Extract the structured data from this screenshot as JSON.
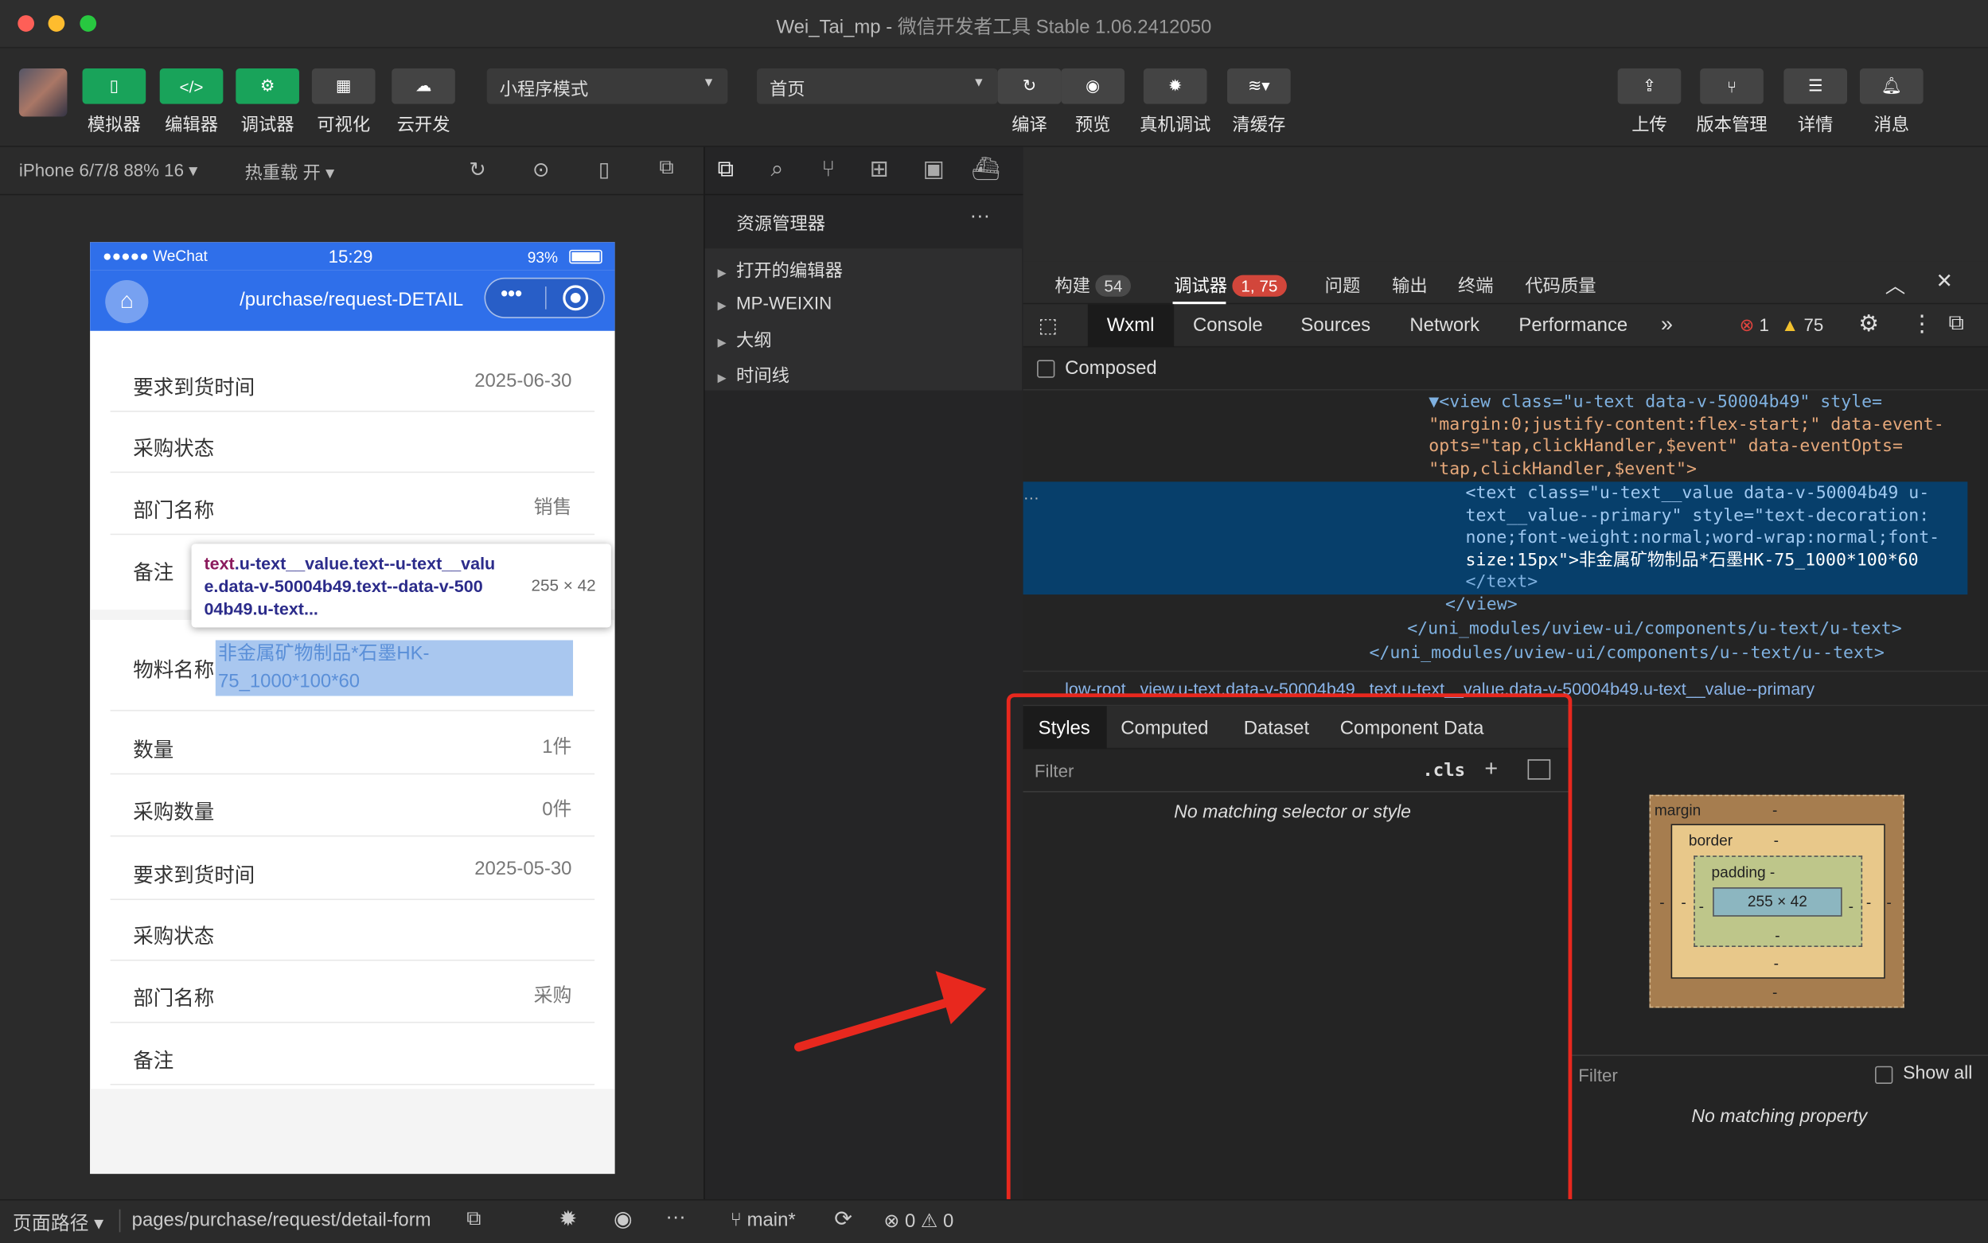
{
  "window": {
    "title": "Wei_Tai_mp",
    "subtitle": "微信开发者工具 Stable 1.06.2412050"
  },
  "toolbar": {
    "left": [
      {
        "label": "模拟器",
        "icon": "phone-icon"
      },
      {
        "label": "编辑器",
        "icon": "code-icon"
      },
      {
        "label": "调试器",
        "icon": "debug-icon"
      },
      {
        "label": "可视化",
        "icon": "layout-icon"
      },
      {
        "label": "云开发",
        "icon": "cloud-icon"
      }
    ],
    "mode": "小程序模式",
    "page": "首页",
    "mid": [
      {
        "label": "编译"
      },
      {
        "label": "预览"
      },
      {
        "label": "真机调试"
      },
      {
        "label": "清缓存"
      }
    ],
    "right": [
      {
        "label": "上传"
      },
      {
        "label": "版本管理"
      },
      {
        "label": "详情"
      },
      {
        "label": "消息"
      }
    ]
  },
  "device": {
    "model": "iPhone 6/7/8 88% 16 ▾",
    "hotreload": "热重载 开 ▾"
  },
  "phone": {
    "carrier": "●●●●● WeChat",
    "time": "15:29",
    "battery": "93%",
    "navtitle": "/purchase/request-DETAIL",
    "rows": [
      {
        "label": "要求到货时间",
        "value": "2025-06-30"
      },
      {
        "label": "采购状态",
        "value": ""
      },
      {
        "label": "部门名称",
        "value": "销售"
      },
      {
        "label": "备注",
        "value": ""
      },
      {
        "label": "物料名称",
        "value": "非金属矿物制品*石墨HK-75_1000*100*60"
      },
      {
        "label": "数量",
        "value": "1件"
      },
      {
        "label": "采购数量",
        "value": "0件"
      },
      {
        "label": "要求到货时间",
        "value": "2025-05-30"
      },
      {
        "label": "采购状态",
        "value": ""
      },
      {
        "label": "部门名称",
        "value": "采购"
      },
      {
        "label": "备注",
        "value": ""
      }
    ],
    "tooltip": {
      "tag": "text",
      "cls": ".u-text__value.text--u-text__valu e.data-v-50004b49.text--data-v-500 04b49.u-text...",
      "size": "255 × 42"
    }
  },
  "explorer": {
    "title": "资源管理器",
    "items": [
      "打开的编辑器",
      "MP-WEIXIN",
      "大纲",
      "时间线"
    ]
  },
  "debugger": {
    "toptabs": [
      {
        "label": "构建",
        "badge": "54"
      },
      {
        "label": "调试器",
        "badge": "1, 75"
      },
      {
        "label": "问题"
      },
      {
        "label": "输出"
      },
      {
        "label": "终端"
      },
      {
        "label": "代码质量"
      }
    ],
    "devtabs": [
      "Wxml",
      "Console",
      "Sources",
      "Network",
      "Performance",
      "»"
    ],
    "errors": "1",
    "warnings": "75",
    "composed": "Composed",
    "code": [
      "▼<view class=\"u-text data-v-50004b49\" style=",
      "\"margin:0;justify-content:flex-start;\" data-event-",
      "opts=\"tap,clickHandler,$event\" data-eventOpts=",
      "\"tap,clickHandler,$event\">",
      "<text class=\"u-text__value data-v-50004b49 u-",
      "text__value--primary\" style=\"text-decoration:",
      "none;font-weight:normal;word-wrap:normal;font-",
      "size:15px\">非金属矿物制品*石墨HK-75_1000*100*60",
      "</text>",
      "</view>",
      "</uni_modules/uview-ui/components/u-text/u-text>",
      "</uni_modules/uview-ui/components/u--text/u--text>"
    ],
    "breadcrumb": "low-root   view.u-text.data-v-50004b49   text.u-text__value.data-v-50004b49.u-text__value--primary",
    "styletabs": [
      "Styles",
      "Computed",
      "Dataset",
      "Component Data"
    ],
    "filter": "Filter",
    "cls": ".cls",
    "nomatch": "No matching selector or style",
    "box": {
      "margin": "margin",
      "border": "border",
      "padding": "padding -",
      "content": "255 × 42",
      "dash": "-"
    },
    "filter2": "Filter",
    "showall": "Show all",
    "nomatchprop": "No matching property"
  },
  "status": {
    "path": "页面路径 ▾",
    "page": "pages/purchase/request/detail-form",
    "branch": "main*",
    "errs": "⊗ 0 ⚠ 0"
  }
}
